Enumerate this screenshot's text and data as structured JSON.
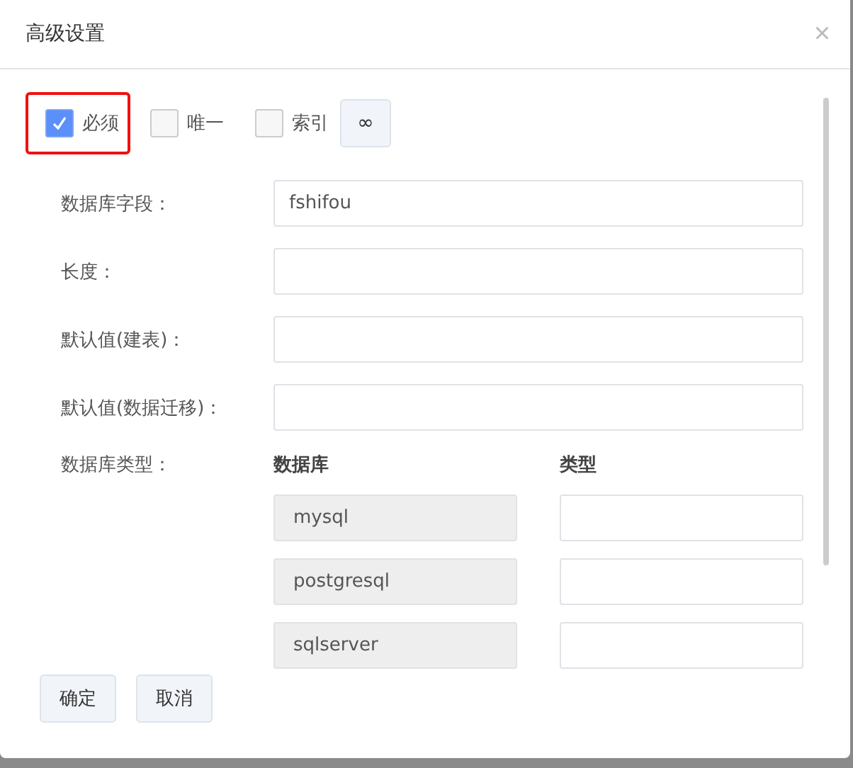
{
  "dialog": {
    "title": "高级设置",
    "close": "×"
  },
  "options": [
    {
      "label": "必须",
      "checked": true,
      "highlighted": true
    },
    {
      "label": "唯一",
      "checked": false,
      "highlighted": false
    },
    {
      "label": "索引",
      "checked": false,
      "highlighted": false
    }
  ],
  "link_button": "∞",
  "fields": [
    {
      "label": "数据库字段：",
      "value": "fshifou"
    },
    {
      "label": "长度："
    },
    {
      "label": "默认值(建表)："
    },
    {
      "label": "默认值(数据迁移)："
    }
  ],
  "db_types": {
    "label": "数据库类型：",
    "columns": [
      "数据库",
      "类型"
    ],
    "rows": [
      {
        "database": "mysql"
      },
      {
        "database": "postgresql"
      },
      {
        "database": "sqlserver"
      }
    ]
  },
  "buttons": [
    "确定",
    "取消"
  ]
}
